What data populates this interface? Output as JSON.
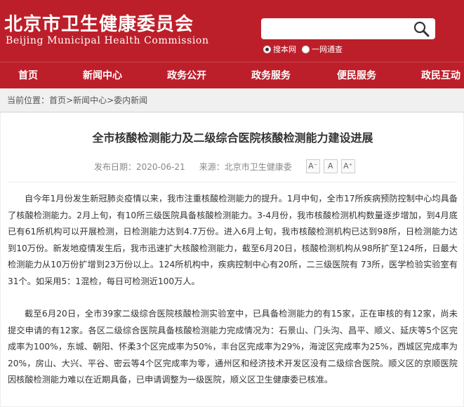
{
  "header": {
    "title_cn": "北京市卫生健康委员会",
    "title_en": "Beijing Municipal Health Commission",
    "search_placeholder": "",
    "scope_site": "搜本网",
    "scope_all": "一网通查"
  },
  "nav": {
    "items": [
      "首页",
      "新闻中心",
      "政务公开",
      "政务服务",
      "便民服务",
      "政民互动"
    ]
  },
  "breadcrumb": {
    "prefix": "当前位置：",
    "path": "首页>新闻中心>委内新闻"
  },
  "article": {
    "title": "全市核酸检测能力及二级综合医院核酸检测能力建设进展",
    "date": "发布日期：2020-06-21",
    "source": "来源：北京市卫生健康委",
    "font_small": "A⁻",
    "font_normal": "A",
    "font_large": "A⁺",
    "paragraph1": "自今年1月份发生新冠肺炎疫情以来，我市注重核酸检测能力的提升。1月中旬，全市17所疾病预防控制中心均具备了核酸检测能力。2月上旬，有10所三级医院具备核酸检测能力。3-4月份，我市核酸检测机构数量逐步增加，到4月底已有61所机构可以开展检测，日检测能力达到4.7万份。进入6月上旬，我市核酸检测机构已达到98所，日检测能力达到10万份。新发地疫情发生后，我市迅速扩大核酸检测能力，截至6月20日，核酸检测机构从98所扩至124所，日最大检测能力从10万份扩增到23万份以上。124所机构中，疾病控制中心有20所，二三级医院有 73所，医学检验实验室有31个。如采用5：1混检，每日可检测近100万人。",
    "paragraph2": "截至6月20日，全市39家二级综合医院核酸检测实验室中，已具备检测能力的有15家，正在审核的有12家，尚未提交申请的有12家。各区二级综合医院具备核酸检测能力完成情况为：石景山、门头沟、昌平、顺义、延庆等5个区完成率为100%，东城、朝阳、怀柔3个区完成率为50%，丰台区完成率为29%，海淀区完成率为25%，西城区完成率为20%，房山、大兴、平谷、密云等4个区完成率为零，通州区和经济技术开发区没有二级综合医院。顺义区的京顺医院因核酸检测能力难以在近期具备，已申请调整为一级医院，顺义区卫生健康委已核准。"
  },
  "colors": {
    "brand_red": "#bd1f2a",
    "breadcrumb_bg": "#f0f0f0"
  }
}
